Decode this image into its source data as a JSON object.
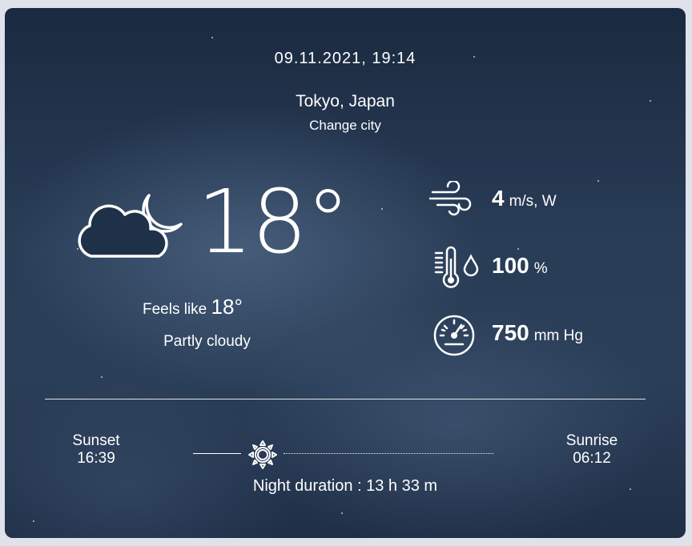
{
  "datetime": "09.11.2021, 19:14",
  "location": {
    "city": "Tokyo, Japan",
    "change_label": "Change city"
  },
  "current": {
    "icon": "partly-cloudy-night-icon",
    "temperature": "18°",
    "feels_like_label": "Feels like",
    "feels_like_value": "18°",
    "description": "Partly cloudy"
  },
  "metrics": {
    "wind": {
      "icon": "wind-icon",
      "value": "4",
      "unit": "m/s, W"
    },
    "humidity": {
      "icon": "humidity-thermometer-icon",
      "value": "100",
      "unit": "%"
    },
    "pressure": {
      "icon": "barometer-icon",
      "value": "750",
      "unit": "mm Hg"
    }
  },
  "sun": {
    "sunset_label": "Sunset",
    "sunset_time": "16:39",
    "sunrise_label": "Sunrise",
    "sunrise_time": "06:12",
    "night_duration": "Night duration : 13 h 33 m",
    "icon": "sun-icon"
  }
}
